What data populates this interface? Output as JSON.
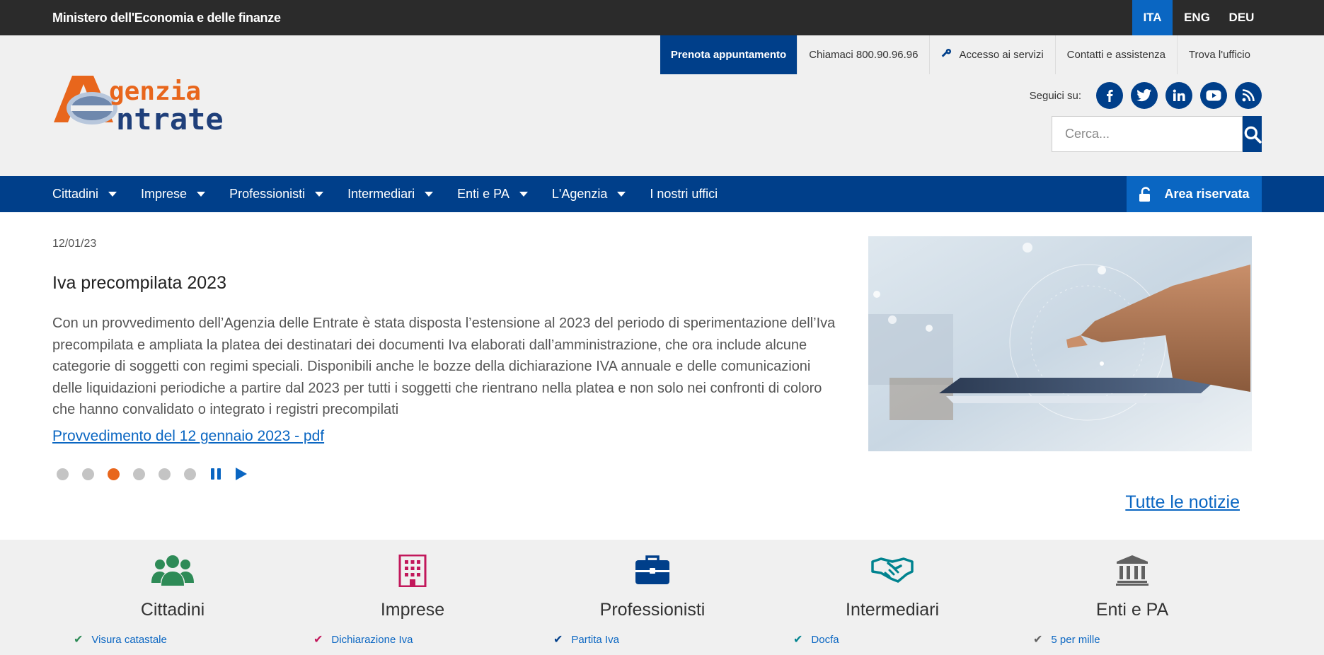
{
  "topbar": {
    "ministry": "Ministero dell'Economia e delle finanze",
    "languages": [
      {
        "label": "ITA",
        "active": true
      },
      {
        "label": "ENG",
        "active": false
      },
      {
        "label": "DEU",
        "active": false
      }
    ]
  },
  "utility": {
    "appointment": "Prenota appuntamento",
    "call": "Chiamaci 800.90.96.96",
    "services": "Accesso ai servizi",
    "contacts": "Contatti e assistenza",
    "office": "Trova l'ufficio"
  },
  "logo": {
    "line1": "genzia",
    "line2": "ntrate"
  },
  "social": {
    "label": "Seguici su:",
    "icons": [
      "facebook-icon",
      "twitter-icon",
      "linkedin-icon",
      "youtube-icon",
      "rss-icon"
    ]
  },
  "search": {
    "placeholder": "Cerca..."
  },
  "nav": {
    "items": [
      "Cittadini",
      "Imprese",
      "Professionisti",
      "Intermediari",
      "Enti e PA",
      "L'Agenzia",
      "I nostri uffici"
    ],
    "reserved": "Area riservata"
  },
  "news": {
    "date": "12/01/23",
    "title": "Iva precompilata 2023",
    "body": "Con un provvedimento dell’Agenzia delle Entrate è stata disposta l’estensione al 2023 del periodo di sperimentazione dell’Iva precompilata e ampliata la platea dei destinatari dei documenti Iva elaborati dall’amministrazione, che ora include alcune categorie di soggetti con regimi speciali. Disponibili anche le bozze della dichiarazione IVA annuale e delle comunicazioni delle liquidazioni periodiche a partire dal 2023 per tutti i soggetti che rientrano nella platea e non solo nei confronti di coloro che hanno convalidato o integrato i registri precompilati",
    "link": "Provvedimento del 12 gennaio 2023 - pdf",
    "slides_total": 6,
    "active_slide": 3,
    "all_news": "Tutte le notizie"
  },
  "categories": [
    {
      "title": "Cittadini",
      "link": "Visura catastale",
      "color": "#2e8b57",
      "icon": "people-icon"
    },
    {
      "title": "Imprese",
      "link": "Dichiarazione Iva",
      "color": "#c2185b",
      "icon": "building-icon"
    },
    {
      "title": "Professionisti",
      "link": "Partita Iva",
      "color": "#003f8a",
      "icon": "briefcase-icon"
    },
    {
      "title": "Intermediari",
      "link": "Docfa",
      "color": "#00838f",
      "icon": "handshake-icon"
    },
    {
      "title": "Enti e PA",
      "link": "5 per mille",
      "color": "#616161",
      "icon": "institution-icon"
    }
  ],
  "colors": {
    "primary": "#003f8a",
    "accent": "#0a66c2",
    "orange": "#e8661c"
  }
}
